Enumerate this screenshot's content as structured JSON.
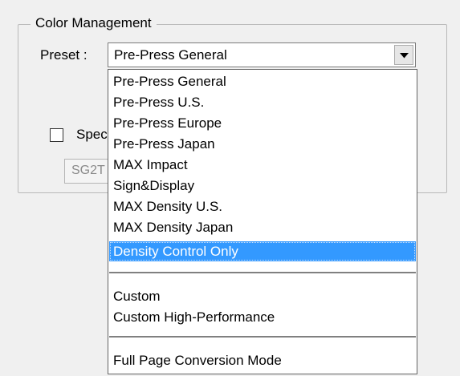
{
  "group": {
    "title": "Color Management"
  },
  "preset": {
    "label": "Preset :",
    "selected_value": "Pre-Press General"
  },
  "specify": {
    "label_visible": "Spec",
    "field_value_visible": "SG2T"
  },
  "dropdown": {
    "groups": [
      [
        "Pre-Press General",
        "Pre-Press U.S.",
        "Pre-Press Europe",
        "Pre-Press Japan",
        "MAX Impact",
        "Sign&Display",
        "MAX Density U.S.",
        "MAX Density Japan",
        "Density Control Only"
      ],
      [
        "Custom",
        "Custom High-Performance"
      ],
      [
        "Full Page Conversion Mode"
      ]
    ],
    "highlighted": "Density Control Only"
  },
  "icons": {
    "combo_arrow": "chevron-down-icon"
  },
  "colors": {
    "highlight_bg": "#3399ff",
    "highlight_text": "#ffffff",
    "window_bg": "#f0f0f0"
  }
}
